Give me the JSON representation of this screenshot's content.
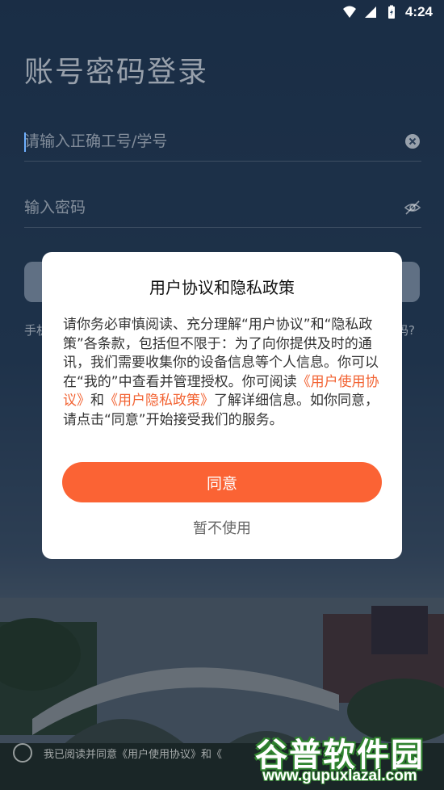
{
  "status_bar": {
    "time": "4:24"
  },
  "login": {
    "title": "账号密码登录",
    "username_placeholder": "请输入正确工号/学号",
    "password_placeholder": "输入密码",
    "side_left": "手机",
    "side_right": "码?",
    "agree_text": "我已阅读并同意《用户使用协议》和《"
  },
  "dialog": {
    "title": "用户协议和隐私政策",
    "body_part1": "请你务必审慎阅读、充分理解“用户协议”和“隐私政策”各条款，包括但不限于：为了向你提供及时的通讯，我们需要收集你的设备信息等个人信息。你可以在“我的”中查看并管理授权。你可阅读",
    "link_terms": "《用户使用协议》",
    "body_and": "和",
    "link_privacy": "《用户隐私政策》",
    "body_part2": "了解详细信息。如你同意，请点击“同意”开始接受我们的服务。",
    "agree_label": "同意",
    "decline_label": "暂不使用"
  },
  "watermark": {
    "brand": "谷普软件园",
    "url": "www.gupuxlazal.com"
  },
  "colors": {
    "accent": "#fb6334",
    "link": "#f26333",
    "dim": "#1a2a3e"
  }
}
